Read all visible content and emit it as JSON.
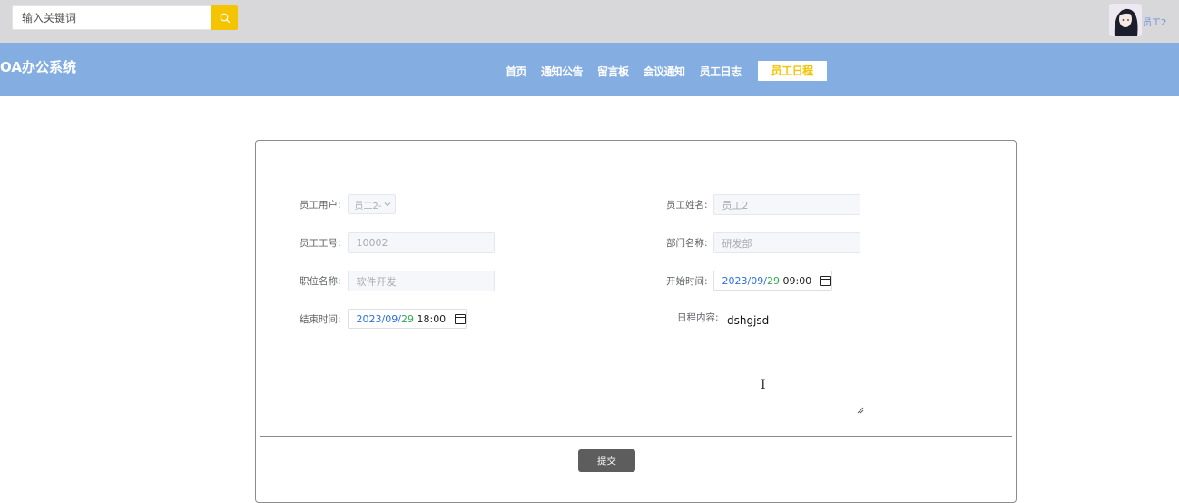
{
  "search": {
    "placeholder": "输入关键词",
    "icon": "search-icon"
  },
  "user": {
    "name": "员工2"
  },
  "brand": "OA办公系统",
  "nav": [
    {
      "label": "首页"
    },
    {
      "label": "通知公告"
    },
    {
      "label": "留言板"
    },
    {
      "label": "会议通知"
    },
    {
      "label": "员工日志"
    },
    {
      "label": "员工日程",
      "active": true
    }
  ],
  "form": {
    "employee_user": {
      "label": "员工用户:",
      "value": "员工2-"
    },
    "employee_name": {
      "label": "员工姓名:",
      "value": "员工2"
    },
    "employee_no": {
      "label": "员工工号:",
      "value": "10002"
    },
    "department": {
      "label": "部门名称:",
      "value": "研发部"
    },
    "position": {
      "label": "职位名称:",
      "value": "软件开发"
    },
    "start_time": {
      "label": "开始时间:",
      "year": "2023",
      "month": "09",
      "day": "29",
      "time": "09:00"
    },
    "end_time": {
      "label": "结束时间:",
      "year": "2023",
      "month": "09",
      "day": "29",
      "time": "18:00"
    },
    "content": {
      "label": "日程内容:",
      "value": "dshgjsd"
    }
  },
  "submit_label": "提交",
  "colors": {
    "topbar": "#d8d8da",
    "navbar": "#84ade2",
    "accent": "#f5c400",
    "date_blue": "#2f6fde",
    "date_green": "#34a853"
  }
}
